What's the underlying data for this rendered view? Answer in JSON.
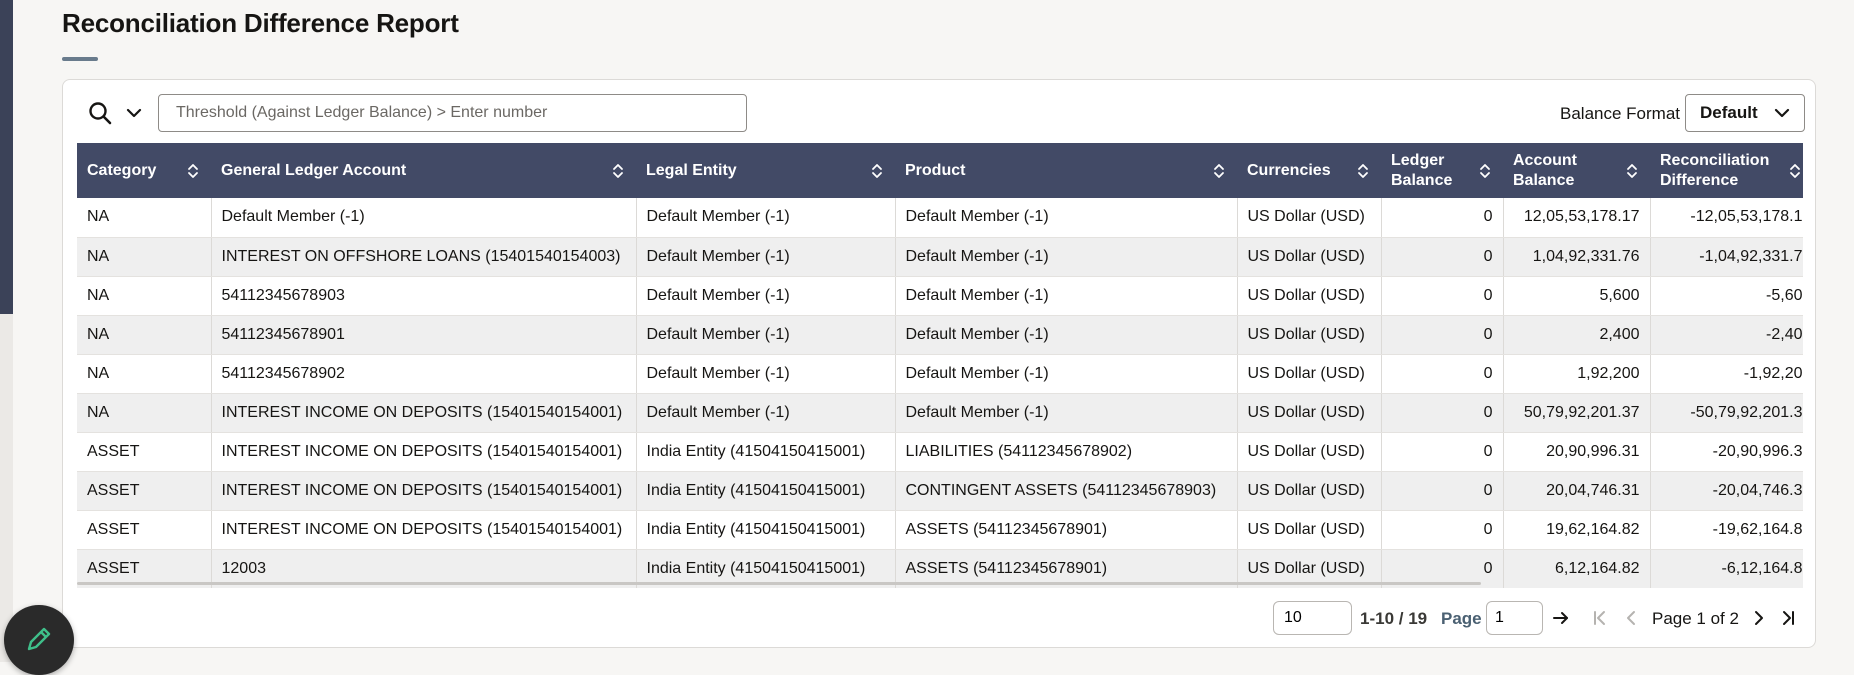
{
  "page": {
    "title": "Reconciliation Difference Report"
  },
  "toolbar": {
    "filter_placeholder": "Threshold (Against Ledger Balance) > Enter number",
    "balance_format_label": "Balance Format",
    "balance_format_value": "Default"
  },
  "table": {
    "columns": [
      "Category",
      "General Ledger Account",
      "Legal Entity",
      "Product",
      "Currencies",
      "Ledger Balance",
      "Account Balance",
      "Reconciliation Difference"
    ],
    "rows": [
      [
        "NA",
        "Default Member (-1)",
        "Default Member (-1)",
        "Default Member (-1)",
        "US Dollar (USD)",
        "0",
        "12,05,53,178.17",
        "-12,05,53,178.1"
      ],
      [
        "NA",
        "INTEREST ON OFFSHORE LOANS (15401540154003)",
        "Default Member (-1)",
        "Default Member (-1)",
        "US Dollar (USD)",
        "0",
        "1,04,92,331.76",
        "-1,04,92,331.7"
      ],
      [
        "NA",
        "54112345678903",
        "Default Member (-1)",
        "Default Member (-1)",
        "US Dollar (USD)",
        "0",
        "5,600",
        "-5,60"
      ],
      [
        "NA",
        "54112345678901",
        "Default Member (-1)",
        "Default Member (-1)",
        "US Dollar (USD)",
        "0",
        "2,400",
        "-2,40"
      ],
      [
        "NA",
        "54112345678902",
        "Default Member (-1)",
        "Default Member (-1)",
        "US Dollar (USD)",
        "0",
        "1,92,200",
        "-1,92,20"
      ],
      [
        "NA",
        "INTEREST INCOME ON DEPOSITS (15401540154001)",
        "Default Member (-1)",
        "Default Member (-1)",
        "US Dollar (USD)",
        "0",
        "50,79,92,201.37",
        "-50,79,92,201.3"
      ],
      [
        "ASSET",
        "INTEREST INCOME ON DEPOSITS (15401540154001)",
        "India Entity (41504150415001)",
        "LIABILITIES (54112345678902)",
        "US Dollar (USD)",
        "0",
        "20,90,996.31",
        "-20,90,996.3"
      ],
      [
        "ASSET",
        "INTEREST INCOME ON DEPOSITS (15401540154001)",
        "India Entity (41504150415001)",
        "CONTINGENT ASSETS (54112345678903)",
        "US Dollar (USD)",
        "0",
        "20,04,746.31",
        "-20,04,746.3"
      ],
      [
        "ASSET",
        "INTEREST INCOME ON DEPOSITS (15401540154001)",
        "India Entity (41504150415001)",
        "ASSETS (54112345678901)",
        "US Dollar (USD)",
        "0",
        "19,62,164.82",
        "-19,62,164.8"
      ],
      [
        "ASSET",
        "12003",
        "India Entity (41504150415001)",
        "ASSETS (54112345678901)",
        "US Dollar (USD)",
        "0",
        "6,12,164.82",
        "-6,12,164.8"
      ]
    ]
  },
  "pagination": {
    "page_size": "10",
    "range": "1-10 / 19",
    "page_label": "Page",
    "current_page": "1",
    "page_of": "Page 1 of 2"
  },
  "icons": {
    "search": "search-icon",
    "filter_toggle": "chevron-down-icon",
    "sort": "sort-icon",
    "go": "arrow-right-icon",
    "first": "first-page-icon",
    "previous": "previous-page-icon",
    "next": "next-page-icon",
    "last": "last-page-icon",
    "edit": "pencil-icon"
  },
  "colors": {
    "header_bg": "#424a66",
    "fab_icon": "#3fbf8a"
  }
}
